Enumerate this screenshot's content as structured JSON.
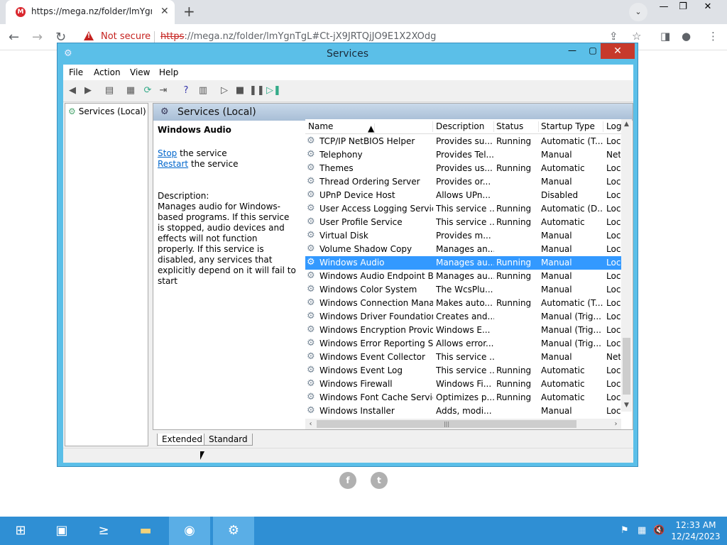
{
  "browser": {
    "tab_title": "https://mega.nz/folder/lmYgnTgL",
    "tab_favicon_letter": "M",
    "security_label": "Not secure",
    "url_scheme": "https",
    "url_rest": "://mega.nz/folder/lmYgnTgL#Ct-jX9JRTQjJO9E1X2XOdg",
    "icons": [
      "close-icon",
      "plus-icon",
      "chevron-down-icon",
      "back-icon",
      "forward-icon",
      "reload-icon",
      "share-icon",
      "star-icon",
      "sidepanel-icon",
      "profile-icon",
      "menu-icon"
    ]
  },
  "services_window": {
    "title": "Services",
    "menu": [
      "File",
      "Action",
      "View",
      "Help"
    ],
    "tree_root": "Services (Local)",
    "pane_header": "Services (Local)",
    "selected_service_name": "Windows Audio",
    "stop_link": "Stop",
    "stop_suffix": " the service",
    "restart_link": "Restart",
    "restart_suffix": " the service",
    "description_label": "Description:",
    "description_text": "Manages audio for Windows-based programs.  If this service is stopped, audio devices and effects will not function properly.  If this service is disabled, any services that explicitly depend on it will fail to start",
    "columns": [
      "Name",
      "Description",
      "Status",
      "Startup Type",
      "Log"
    ],
    "rows": [
      {
        "name": "TCP/IP NetBIOS Helper",
        "desc": "Provides su...",
        "status": "Running",
        "startup": "Automatic (T...",
        "log": "Loc"
      },
      {
        "name": "Telephony",
        "desc": "Provides Tel...",
        "status": "",
        "startup": "Manual",
        "log": "Net"
      },
      {
        "name": "Themes",
        "desc": "Provides us...",
        "status": "Running",
        "startup": "Automatic",
        "log": "Loc"
      },
      {
        "name": "Thread Ordering Server",
        "desc": "Provides or...",
        "status": "",
        "startup": "Manual",
        "log": "Loc"
      },
      {
        "name": "UPnP Device Host",
        "desc": "Allows UPn...",
        "status": "",
        "startup": "Disabled",
        "log": "Loc"
      },
      {
        "name": "User Access Logging Service",
        "desc": "This service ...",
        "status": "Running",
        "startup": "Automatic (D...",
        "log": "Loc"
      },
      {
        "name": "User Profile Service",
        "desc": "This service ...",
        "status": "Running",
        "startup": "Automatic",
        "log": "Loc"
      },
      {
        "name": "Virtual Disk",
        "desc": "Provides m...",
        "status": "",
        "startup": "Manual",
        "log": "Loc"
      },
      {
        "name": "Volume Shadow Copy",
        "desc": "Manages an...",
        "status": "",
        "startup": "Manual",
        "log": "Loc"
      },
      {
        "name": "Windows Audio",
        "desc": "Manages au...",
        "status": "Running",
        "startup": "Manual",
        "log": "Loc"
      },
      {
        "name": "Windows Audio Endpoint B...",
        "desc": "Manages au...",
        "status": "Running",
        "startup": "Manual",
        "log": "Loc"
      },
      {
        "name": "Windows Color System",
        "desc": "The WcsPlu...",
        "status": "",
        "startup": "Manual",
        "log": "Loc"
      },
      {
        "name": "Windows Connection Mana...",
        "desc": "Makes auto...",
        "status": "Running",
        "startup": "Automatic (T...",
        "log": "Loc"
      },
      {
        "name": "Windows Driver Foundation...",
        "desc": "Creates and...",
        "status": "",
        "startup": "Manual (Trig...",
        "log": "Loc"
      },
      {
        "name": "Windows Encryption Provid...",
        "desc": "Windows E...",
        "status": "",
        "startup": "Manual (Trig...",
        "log": "Loc"
      },
      {
        "name": "Windows Error Reporting Se...",
        "desc": "Allows error...",
        "status": "",
        "startup": "Manual (Trig...",
        "log": "Loc"
      },
      {
        "name": "Windows Event Collector",
        "desc": "This service ...",
        "status": "",
        "startup": "Manual",
        "log": "Net"
      },
      {
        "name": "Windows Event Log",
        "desc": "This service ...",
        "status": "Running",
        "startup": "Automatic",
        "log": "Loc"
      },
      {
        "name": "Windows Firewall",
        "desc": "Windows Fi...",
        "status": "Running",
        "startup": "Automatic",
        "log": "Loc"
      },
      {
        "name": "Windows Font Cache Service",
        "desc": "Optimizes p...",
        "status": "Running",
        "startup": "Automatic",
        "log": "Loc"
      },
      {
        "name": "Windows Installer",
        "desc": "Adds, modi...",
        "status": "",
        "startup": "Manual",
        "log": "Loc"
      }
    ],
    "selected_row_index": 9,
    "tabs": [
      "Extended",
      "Standard"
    ],
    "active_tab": "Extended"
  },
  "page": {
    "social_labels": [
      "f",
      "t"
    ]
  },
  "taskbar": {
    "clock_time": "12:33 AM",
    "clock_date": "12/24/2023"
  },
  "colors": {
    "window_frame": "#5bbfe8",
    "selection": "#3399ff",
    "taskbar": "#2f8fd4",
    "close_button": "#c7392b",
    "warning_red": "#c5221f"
  }
}
